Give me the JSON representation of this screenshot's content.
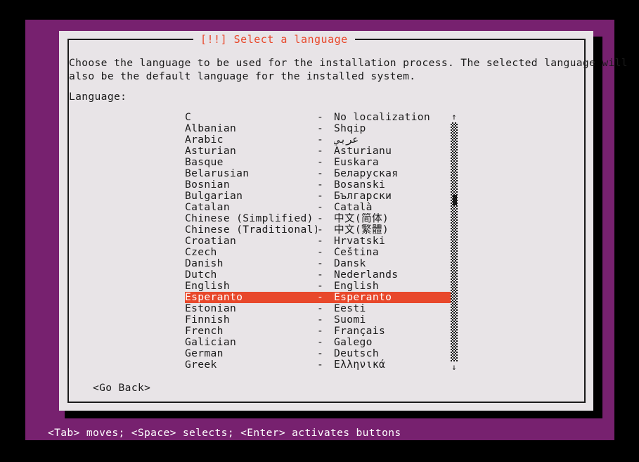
{
  "dialog": {
    "title": "[!!] Select a language",
    "description_line_1": "Choose the language to be used for the installation process. The selected language will",
    "description_line_2": "also be the default language for the installed system.",
    "language_label": "Language:",
    "go_back_label": "<Go Back>"
  },
  "colors": {
    "backdrop_purple": "#77216f",
    "dialog_background": "#e8e4e7",
    "title_red": "#e8482b",
    "highlight_red": "#e8482b",
    "text_black": "#1a1a1a",
    "status_text": "#ffffff",
    "screen_black": "#000000"
  },
  "list": {
    "selected_index": 16,
    "separator": "-",
    "items": [
      {
        "name": "C",
        "native": "No localization"
      },
      {
        "name": "Albanian",
        "native": "Shqip"
      },
      {
        "name": "Arabic",
        "native": "عربي"
      },
      {
        "name": "Asturian",
        "native": "Asturianu"
      },
      {
        "name": "Basque",
        "native": "Euskara"
      },
      {
        "name": "Belarusian",
        "native": "Беларуская"
      },
      {
        "name": "Bosnian",
        "native": "Bosanski"
      },
      {
        "name": "Bulgarian",
        "native": "Български"
      },
      {
        "name": "Catalan",
        "native": "Català"
      },
      {
        "name": "Chinese (Simplified)",
        "native": "中文(简体)"
      },
      {
        "name": "Chinese (Traditional)",
        "native": "中文(繁體)"
      },
      {
        "name": "Croatian",
        "native": "Hrvatski"
      },
      {
        "name": "Czech",
        "native": "Čeština"
      },
      {
        "name": "Danish",
        "native": "Dansk"
      },
      {
        "name": "Dutch",
        "native": "Nederlands"
      },
      {
        "name": "English",
        "native": "English"
      },
      {
        "name": "Esperanto",
        "native": "Esperanto"
      },
      {
        "name": "Estonian",
        "native": "Eesti"
      },
      {
        "name": "Finnish",
        "native": "Suomi"
      },
      {
        "name": "French",
        "native": "Français"
      },
      {
        "name": "Galician",
        "native": "Galego"
      },
      {
        "name": "German",
        "native": "Deutsch"
      },
      {
        "name": "Greek",
        "native": "Ελληνικά"
      }
    ]
  },
  "scrollbar": {
    "up_arrow": "↑",
    "down_arrow": "↓"
  },
  "statusbar": {
    "text": "<Tab> moves; <Space> selects; <Enter> activates buttons"
  }
}
